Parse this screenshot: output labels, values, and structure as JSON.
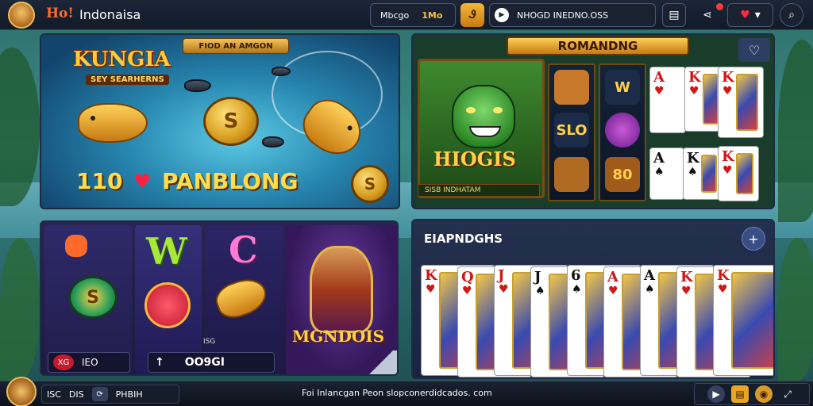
{
  "header": {
    "brand_mark": "Ho!",
    "brand_name": "Indonaisa",
    "user_label": "Mbcgo",
    "balance": "1Mo",
    "gold_button": "Ꮽ",
    "promo_text": "NHOGD INEDNO.OSS",
    "heart_count": "▾"
  },
  "panels": {
    "fishing": {
      "banner": "FIOD AN AMGON",
      "title": "KUNGIA",
      "subtitle": "SEY SEARHERNS",
      "count": "110",
      "label": "PANBLONG",
      "coin_symbol": "S"
    },
    "jungle": {
      "banner": "ROMANDNG",
      "hero_title": "HIOGIS",
      "hero_footer": "SISB INDHATAM",
      "reel_syms": [
        "SLO",
        "80",
        "W"
      ]
    },
    "slots": {
      "letter_w": "W",
      "letter_c": "C",
      "chip_symbol": "S",
      "logo": "MGNDOIS",
      "small_label": "ISG",
      "field1_dot": "XG",
      "field1_value": "IEO",
      "field2_icon": "↑",
      "field2_value": "OO9GI"
    },
    "cards": {
      "title": "EIAPNDGHS",
      "add_icon": "+",
      "hand": [
        {
          "rank": "K",
          "suit": "♥",
          "color": "red"
        },
        {
          "rank": "Q",
          "suit": "♥",
          "color": "red"
        },
        {
          "rank": "J",
          "suit": "♥",
          "color": "red"
        },
        {
          "rank": "J",
          "suit": "♠",
          "color": "black"
        },
        {
          "rank": "6",
          "suit": "♠",
          "color": "black"
        },
        {
          "rank": "A",
          "suit": "♥",
          "color": "red"
        },
        {
          "rank": "A",
          "suit": "♠",
          "color": "black"
        },
        {
          "rank": "K",
          "suit": "♥",
          "color": "red"
        },
        {
          "rank": "K",
          "suit": "♥",
          "color": "red"
        }
      ]
    }
  },
  "footer": {
    "stat1": "ISC",
    "stat2": "DIS",
    "sync_icon": "⟳",
    "stat3": "PHBIH",
    "center_text": "Foi Inlancgan Peon slopconerdidcados. com",
    "play_icon": "▶",
    "gold_icon": "▤",
    "coin_icon": "◉",
    "expand_icon": "⤢"
  },
  "icons": {
    "search": "search-icon",
    "menu": "menu-icon",
    "share": "share-icon",
    "heart": "heart-icon",
    "play": "play-icon"
  },
  "colors": {
    "accent_gold": "#f0c24a",
    "topbar": "#121a28",
    "heart_red": "#ff2a3a"
  }
}
